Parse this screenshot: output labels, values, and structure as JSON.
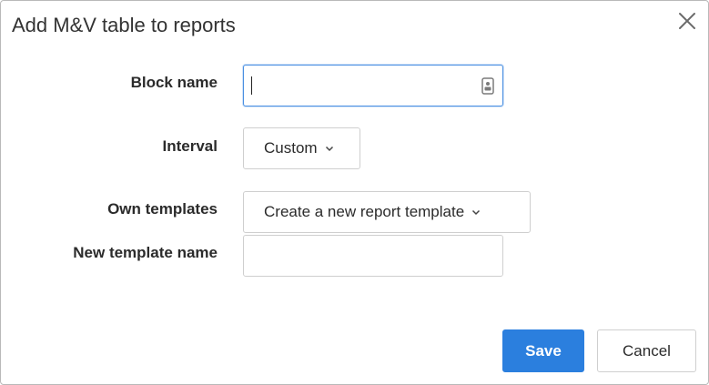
{
  "dialog": {
    "title": "Add M&V table to reports"
  },
  "form": {
    "block_name": {
      "label": "Block name",
      "value": ""
    },
    "interval": {
      "label": "Interval",
      "selected": "Custom"
    },
    "own_templates": {
      "label": "Own templates",
      "selected": "Create a new report template"
    },
    "new_template_name": {
      "label": "New template name",
      "value": ""
    }
  },
  "actions": {
    "save_label": "Save",
    "cancel_label": "Cancel"
  },
  "colors": {
    "primary": "#2b7fde",
    "focus_border": "#4a90e2"
  }
}
